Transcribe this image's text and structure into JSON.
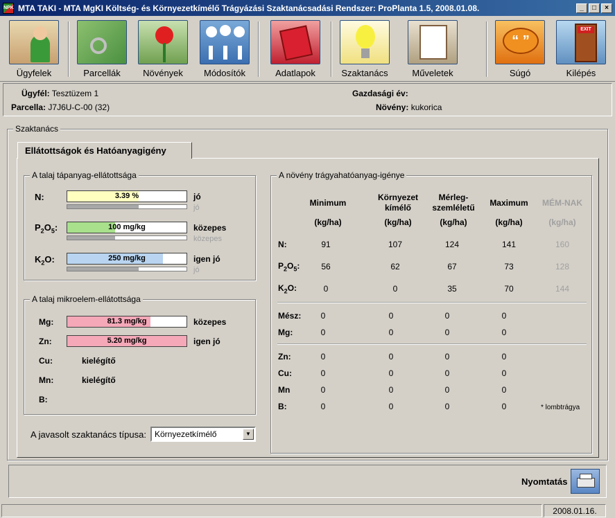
{
  "window": {
    "title": "MTA TAKI - MTA MgKI  Költség- és Környezetkímélő Trágyázási Szaktanácsadási Rendszer: ProPlanta 1.5, 2008.01.08.",
    "app_icon_text": "NPK"
  },
  "toolbar": {
    "items": [
      {
        "label": "Ügyfelek",
        "icon": "client-book-icon"
      },
      {
        "label": "Parcellák",
        "icon": "field-map-icon"
      },
      {
        "label": "Növények",
        "icon": "flower-icon"
      },
      {
        "label": "Módosítók",
        "icon": "gauges-icon"
      },
      {
        "label": "Adatlapok",
        "icon": "notebook-icon"
      },
      {
        "label": "Szaktanács",
        "icon": "lightbulb-icon"
      },
      {
        "label": "Műveletek",
        "icon": "checklist-icon"
      },
      {
        "label": "Súgó",
        "icon": "speech-bubble-icon"
      },
      {
        "label": "Kilépés",
        "icon": "exit-door-icon"
      }
    ],
    "exit_sign": "EXIT"
  },
  "info": {
    "client_label": "Ügyfél:",
    "client_value": "Tesztüzem 1",
    "parcel_label": "Parcella:",
    "parcel_value": "J7J6U-C-00 (32)",
    "year_label": "Gazdasági év:",
    "year_value": "",
    "plant_label": "Növény:",
    "plant_value": "kukorica"
  },
  "main": {
    "group_title": "Szaktanács",
    "tab_label": "Ellátottságok és Hatóanyagigény"
  },
  "soil_nutrient": {
    "title": "A talaj tápanyag-ellátottsága",
    "rows": [
      {
        "el": "N",
        "sub": "",
        "suffix": ":",
        "value": "3.39 %",
        "fill_pct": 60,
        "fill_color": "#ffffc0",
        "level": "jó",
        "sub_level": "jó",
        "sub_fill_pct": 60
      },
      {
        "el": "P",
        "sub": "2",
        "el2": "O",
        "sub2": "5",
        "suffix": ":",
        "value": "100 mg/kg",
        "fill_pct": 40,
        "fill_color": "#a8e08c",
        "level": "közepes",
        "sub_level": "közepes",
        "sub_fill_pct": 40
      },
      {
        "el": "K",
        "sub": "2",
        "el2": "O",
        "suffix": ":",
        "value": "250 mg/kg",
        "fill_pct": 80,
        "fill_color": "#b8d4f0",
        "level": "igen jó",
        "sub_level": "jó",
        "sub_fill_pct": 60
      }
    ]
  },
  "soil_micro": {
    "title": "A talaj mikroelem-ellátottsága",
    "bars": [
      {
        "label": "Mg:",
        "value": "81.3 mg/kg",
        "fill_pct": 70,
        "fill_color": "#f4a8b8",
        "level": "közepes"
      },
      {
        "label": "Zn:",
        "value": "5.20 mg/kg",
        "fill_pct": 100,
        "fill_color": "#f4a8b8",
        "level": "igen jó"
      }
    ],
    "texts": [
      {
        "label": "Cu:",
        "value": "kielégítő"
      },
      {
        "label": "Mn:",
        "value": "kielégítő"
      },
      {
        "label": "B:",
        "value": ""
      }
    ]
  },
  "advice_type": {
    "label": "A javasolt szaktanács típusa:",
    "value": "Környezetkímélő"
  },
  "plant_demand": {
    "title": "A növény trágyahatóanyag-igénye",
    "columns": [
      {
        "name": "Minimum",
        "unit": "(kg/ha)"
      },
      {
        "name": "Környezet kímélő",
        "unit": "(kg/ha)"
      },
      {
        "name": "Mérleg-szemléletű",
        "unit": "(kg/ha)"
      },
      {
        "name": "Maximum",
        "unit": "(kg/ha)"
      },
      {
        "name": "MÉM-NAK",
        "unit": "(kg/ha)"
      }
    ],
    "main_rows": [
      {
        "label": "N:",
        "values": [
          "91",
          "107",
          "124",
          "141",
          "160"
        ]
      },
      {
        "label": "P2O5:",
        "values": [
          "56",
          "62",
          "67",
          "73",
          "128"
        ]
      },
      {
        "label": "K2O:",
        "values": [
          "0",
          "0",
          "35",
          "70",
          "144"
        ]
      }
    ],
    "mid_rows": [
      {
        "label": "Mész:",
        "values": [
          "0",
          "0",
          "0",
          "0"
        ]
      },
      {
        "label": "Mg:",
        "values": [
          "0",
          "0",
          "0",
          "0"
        ]
      }
    ],
    "micro_rows": [
      {
        "label": "Zn:",
        "values": [
          "0",
          "0",
          "0",
          "0"
        ]
      },
      {
        "label": "Cu:",
        "values": [
          "0",
          "0",
          "0",
          "0"
        ]
      },
      {
        "label": "Mn",
        "values": [
          "0",
          "0",
          "0",
          "0"
        ]
      },
      {
        "label": "B:",
        "values": [
          "0",
          "0",
          "0",
          "0"
        ]
      }
    ],
    "footnote": "* lombtrágya"
  },
  "footer": {
    "print_label": "Nyomtatás",
    "status_date": "2008.01.16."
  }
}
